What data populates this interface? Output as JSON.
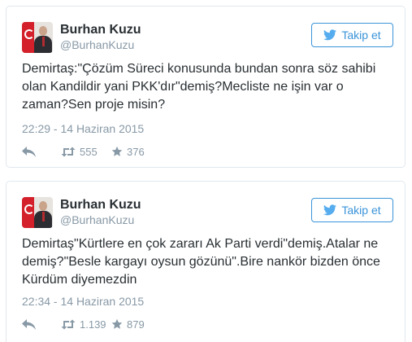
{
  "tweets": [
    {
      "user": {
        "name": "Burhan Kuzu",
        "handle": "@BurhanKuzu"
      },
      "follow_label": "Takip et",
      "text": "Demirtaş:\"Çözüm Süreci konusunda bundan sonra söz sahibi olan Kandildir yani PKK'dır\"demiş?Mecliste ne işin var o zaman?Sen proje misin?",
      "timestamp": "22:29 - 14 Haziran 2015",
      "retweets": "555",
      "favorites": "376"
    },
    {
      "user": {
        "name": "Burhan Kuzu",
        "handle": "@BurhanKuzu"
      },
      "follow_label": "Takip et",
      "text": "Demirtaş\"Kürtlere en çok zararı Ak Parti verdi\"demiş.Atalar ne demiş?\"Besle kargayı oysun gözünü\".Bire nankör bizden önce Kürdüm diyemezdin",
      "timestamp": "22:34 - 14 Haziran 2015",
      "retweets": "1.139",
      "favorites": "879"
    }
  ],
  "icons": {
    "bird": "twitter-bird-icon",
    "reply": "reply-icon",
    "retweet": "retweet-icon",
    "favorite": "star-icon"
  },
  "colors": {
    "accent": "#55acee",
    "muted": "#8899a6",
    "text": "#292f33",
    "border": "#e1e8ed"
  }
}
